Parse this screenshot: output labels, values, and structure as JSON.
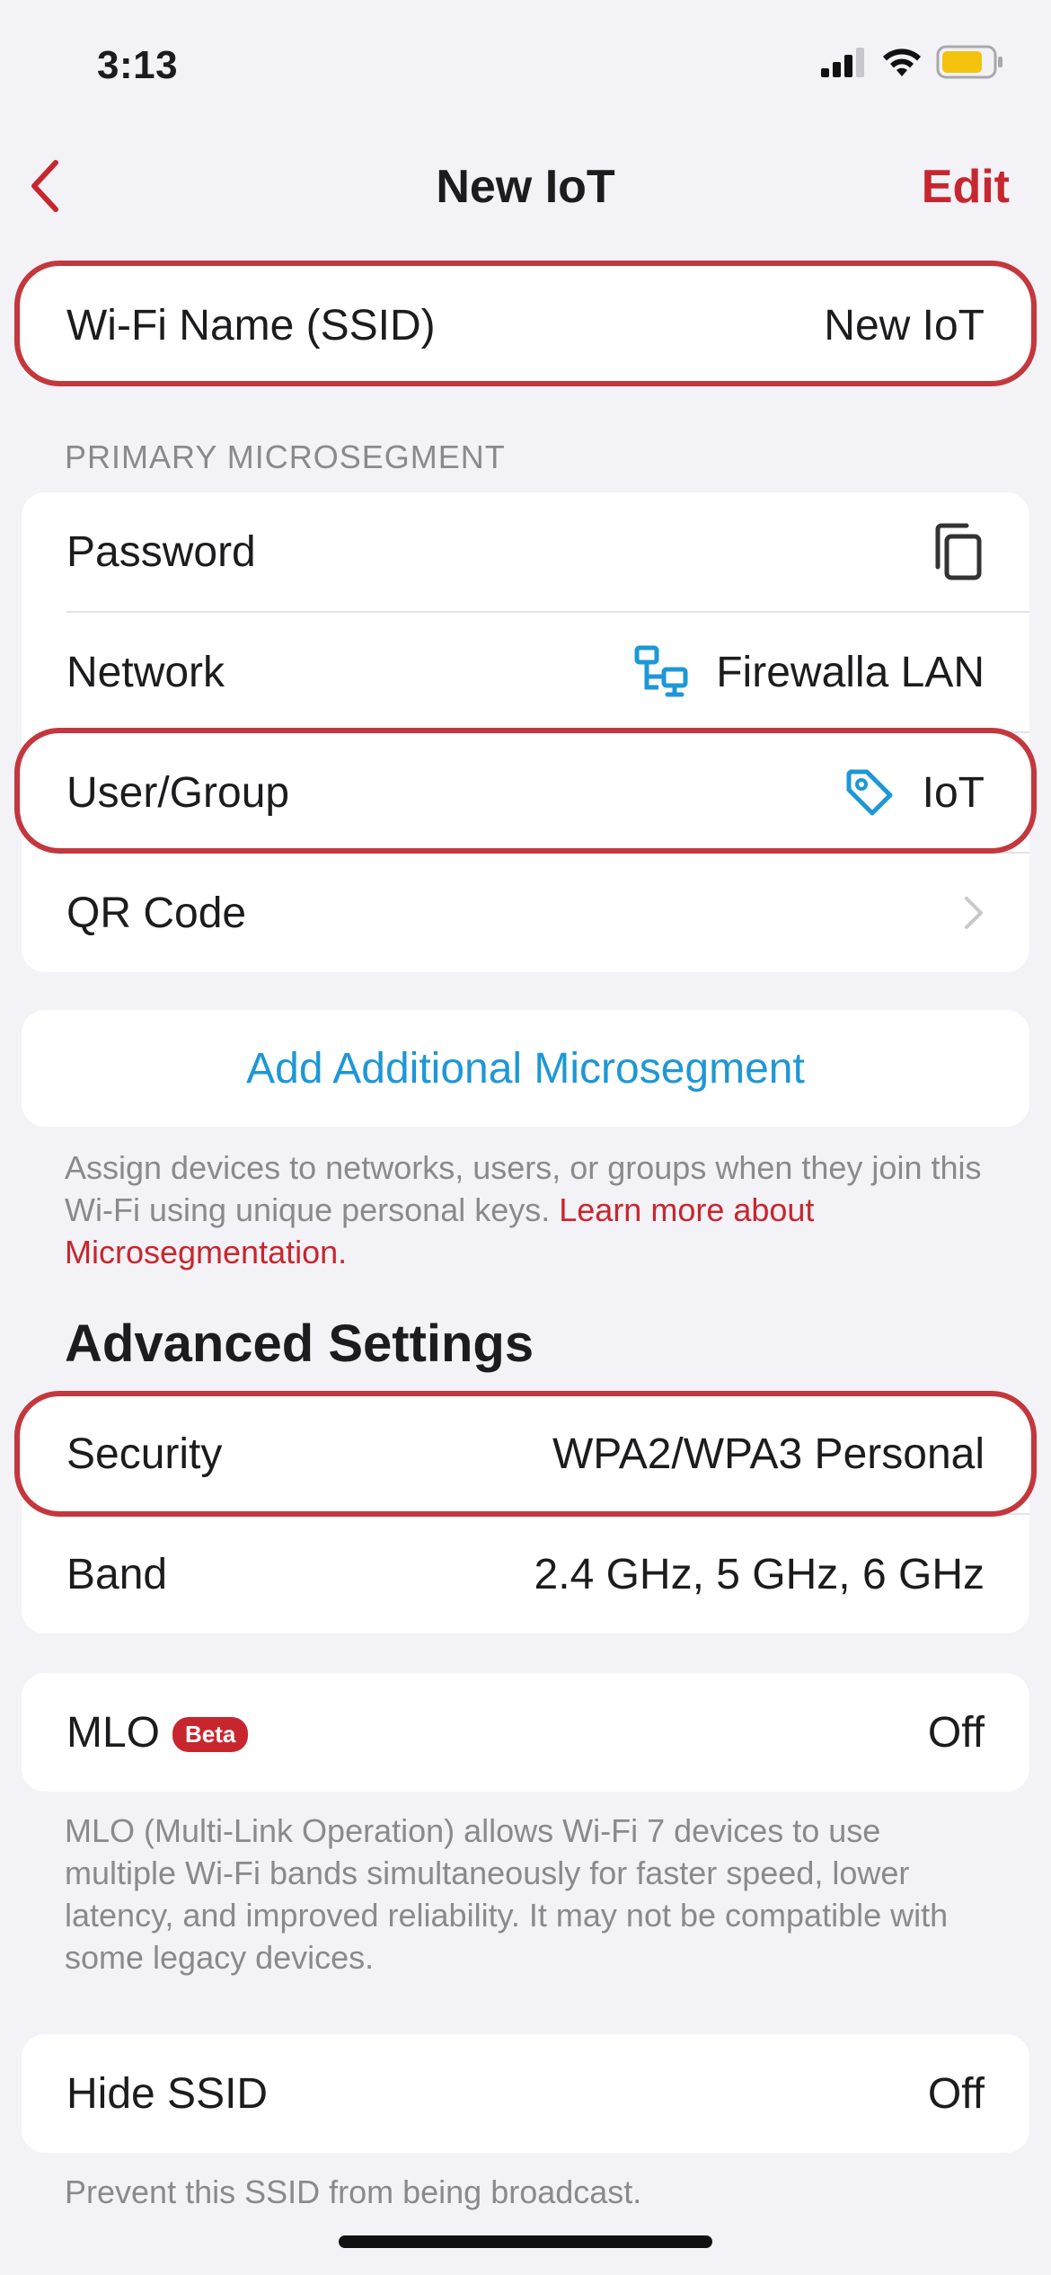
{
  "status_bar": {
    "time": "3:13"
  },
  "nav": {
    "title": "New IoT",
    "edit_label": "Edit"
  },
  "ssid_row": {
    "label": "Wi-Fi Name (SSID)",
    "value": "New IoT"
  },
  "primary_section": {
    "header": "PRIMARY MICROSEGMENT",
    "password_label": "Password",
    "network_label": "Network",
    "network_value": "Firewalla LAN",
    "user_group_label": "User/Group",
    "user_group_value": "IoT",
    "qr_label": "QR Code"
  },
  "add_microsegment": {
    "label": "Add Additional Microsegment"
  },
  "microsegment_footer": {
    "text": "Assign devices to networks, users, or groups when they join this Wi-Fi using unique personal keys. ",
    "link": "Learn more about Microsegmentation."
  },
  "advanced": {
    "title": "Advanced Settings",
    "security_label": "Security",
    "security_value": "WPA2/WPA3 Personal",
    "band_label": "Band",
    "band_value": "2.4 GHz, 5 GHz, 6 GHz"
  },
  "mlo": {
    "label": "MLO",
    "badge": "Beta",
    "value": "Off",
    "footer": "MLO (Multi-Link Operation) allows Wi-Fi 7 devices to use multiple Wi-Fi bands simultaneously for faster speed, lower latency, and improved reliability. It may not be compatible with some legacy devices."
  },
  "hide_ssid": {
    "label": "Hide SSID",
    "value": "Off",
    "footer": "Prevent this SSID from being broadcast."
  },
  "colors": {
    "accent_red": "#c8262e",
    "accent_blue": "#1e97d6",
    "background": "#f2f2f7"
  }
}
